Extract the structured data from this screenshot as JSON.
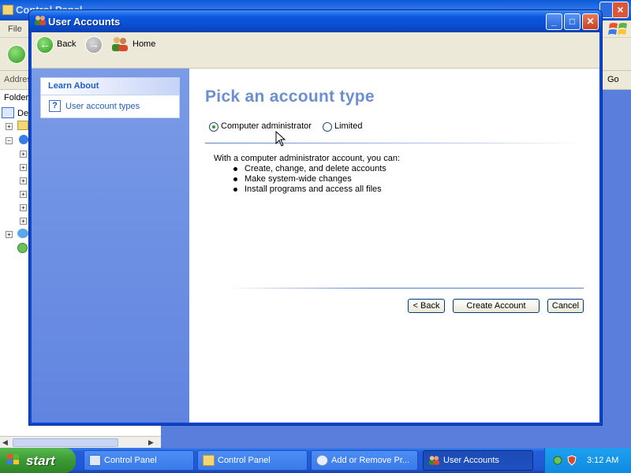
{
  "background_window": {
    "title": "Control Panel",
    "menu_file": "File",
    "address_label": "Address",
    "go_label": "Go",
    "folders_label": "Folders",
    "tree_first_label": "De"
  },
  "window": {
    "title": "User Accounts",
    "controls": {
      "minimize": "_",
      "maximize": "□",
      "close": "✕"
    }
  },
  "toolbar": {
    "back_label": "Back",
    "forward_icon": "forward-arrow-icon",
    "home_label": "Home"
  },
  "learn_about": {
    "header": "Learn About",
    "link": "User account types"
  },
  "main": {
    "title": "Pick an account type",
    "options": [
      {
        "label": "Computer administrator",
        "selected": true
      },
      {
        "label": "Limited",
        "selected": false
      }
    ],
    "description": "With a computer administrator account, you can:",
    "bullets": [
      "Create, change, and delete accounts",
      "Make system-wide changes",
      "Install programs and access all files"
    ],
    "buttons": {
      "back": "< Back",
      "create": "Create Account",
      "cancel": "Cancel"
    }
  },
  "taskbar": {
    "start_label": "start",
    "tasks": [
      {
        "label": "Control Panel",
        "active": false
      },
      {
        "label": "Control Panel",
        "active": false
      },
      {
        "label": "Add or Remove Pr...",
        "active": false
      },
      {
        "label": "User Accounts",
        "active": true
      }
    ],
    "clock": "3:12 AM"
  },
  "colors": {
    "title_blue": "#0a4ed2",
    "left_pane": "#6f91e3",
    "heading": "#6b8fd0",
    "link": "#215dc6",
    "start_green": "#3b9a33",
    "taskbar_blue": "#245edb"
  }
}
